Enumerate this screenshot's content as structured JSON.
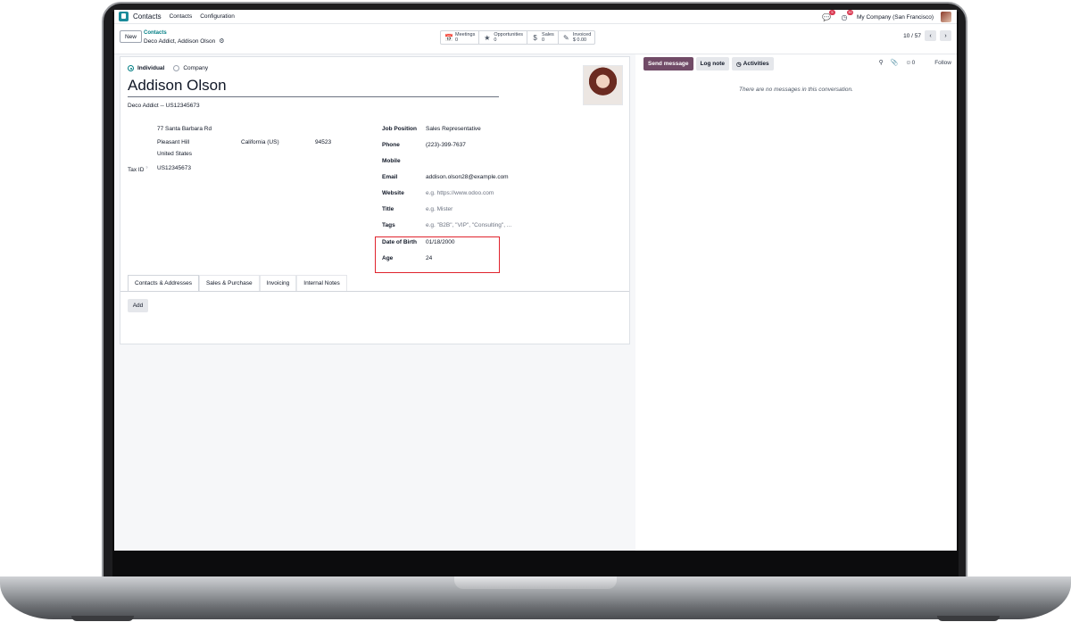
{
  "topnav": {
    "app_name": "Contacts",
    "menu": [
      "Contacts",
      "Configuration"
    ],
    "chat_badge": "5",
    "activity_badge": "30",
    "company": "My Company (San Francisco)"
  },
  "control": {
    "new_label": "New",
    "breadcrumb_parent": "Contacts",
    "breadcrumb_current": "Deco Addict, Addison Olson",
    "smart_buttons": [
      {
        "label": "Meetings",
        "value": "0",
        "icon": "calendar-icon"
      },
      {
        "label": "Opportunities",
        "value": "0",
        "icon": "star-icon"
      },
      {
        "label": "Sales",
        "value": "0",
        "icon": "dollar-icon"
      },
      {
        "label": "Invoiced",
        "value": "$ 0.00",
        "icon": "edit-icon"
      }
    ],
    "pager": "10 / 57"
  },
  "form": {
    "type_individual": "Individual",
    "type_company": "Company",
    "name": "Addison Olson",
    "company_line": "Deco Addict -- US12345673",
    "street": "77 Santa Barbara Rd",
    "city": "Pleasant Hill",
    "state": "California (US)",
    "zip": "94523",
    "country": "United States",
    "tax_label": "Tax ID",
    "tax_help": "?",
    "tax_value": "US12345673",
    "fields": [
      {
        "label": "Job Position",
        "value": "Sales Representative",
        "placeholder": false
      },
      {
        "label": "Phone",
        "value": "(223)-399-7637",
        "placeholder": false
      },
      {
        "label": "Mobile",
        "value": "",
        "placeholder": false
      },
      {
        "label": "Email",
        "value": "addison.olson28@example.com",
        "placeholder": false
      },
      {
        "label": "Website",
        "value": "e.g. https://www.odoo.com",
        "placeholder": true
      },
      {
        "label": "Title",
        "value": "e.g. Mister",
        "placeholder": true
      },
      {
        "label": "Tags",
        "value": "e.g. \"B2B\", \"VIP\", \"Consulting\", ...",
        "placeholder": true
      },
      {
        "label": "Date of Birth",
        "value": "01/18/2000",
        "placeholder": false
      },
      {
        "label": "Age",
        "value": "24",
        "placeholder": false
      }
    ],
    "tabs": [
      "Contacts & Addresses",
      "Sales & Purchase",
      "Invoicing",
      "Internal Notes"
    ],
    "active_tab": "Contacts & Addresses",
    "add_label": "Add"
  },
  "chatter": {
    "send_message": "Send message",
    "log_note": "Log note",
    "activities": "Activities",
    "followers_count": "0",
    "follow": "Follow",
    "empty_text": "There are no messages in this conversation."
  },
  "colors": {
    "accent": "#017e84",
    "primary": "#714b67",
    "highlight": "#e0232d"
  }
}
